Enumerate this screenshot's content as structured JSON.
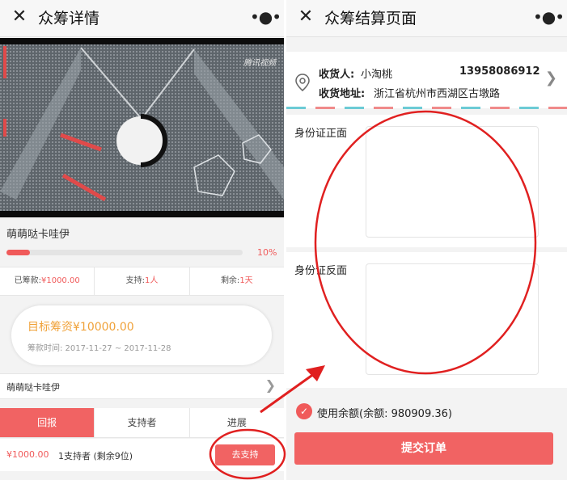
{
  "left": {
    "nav": {
      "close_icon": "close-icon",
      "title": "众筹详情",
      "more_icon": "more-icon"
    },
    "video": {
      "logo": "腾讯视频"
    },
    "project_title": "萌萌哒卡哇伊",
    "progress": {
      "percent": 10,
      "label": "10%"
    },
    "stats": {
      "raised_label": "已筹款:",
      "raised_value": "¥1000.00",
      "supporters_label": "支持:",
      "supporters_value": "1人",
      "remaining_label": "剩余:",
      "remaining_value": "1天"
    },
    "target": {
      "title": "目标筹资¥10000.00",
      "dates": "筹款时间: 2017-11-27 ~ 2017-11-28"
    },
    "owner": {
      "name": "萌萌哒卡哇伊"
    },
    "tabs": [
      {
        "label": "回报",
        "active": true
      },
      {
        "label": "支持者",
        "active": false
      },
      {
        "label": "进展",
        "active": false
      }
    ],
    "reward": {
      "price": "¥1000.00",
      "info": "1支持者 (剩余9位)",
      "button": "去支持"
    }
  },
  "right": {
    "nav": {
      "title": "众筹结算页面"
    },
    "address": {
      "name_label": "收货人:",
      "name": "小淘桃",
      "phone": "13958086912",
      "addr_label": "收货地址:",
      "addr": "浙江省杭州市西湖区古墩路"
    },
    "id_front_label": "身份证正面",
    "id_back_label": "身份证反面",
    "balance": "使用余额(余额: 980909.36)",
    "submit": "提交订单"
  },
  "colors": {
    "accent": "#f16363",
    "warning": "#f0a23a",
    "annotation": "#e02020"
  }
}
